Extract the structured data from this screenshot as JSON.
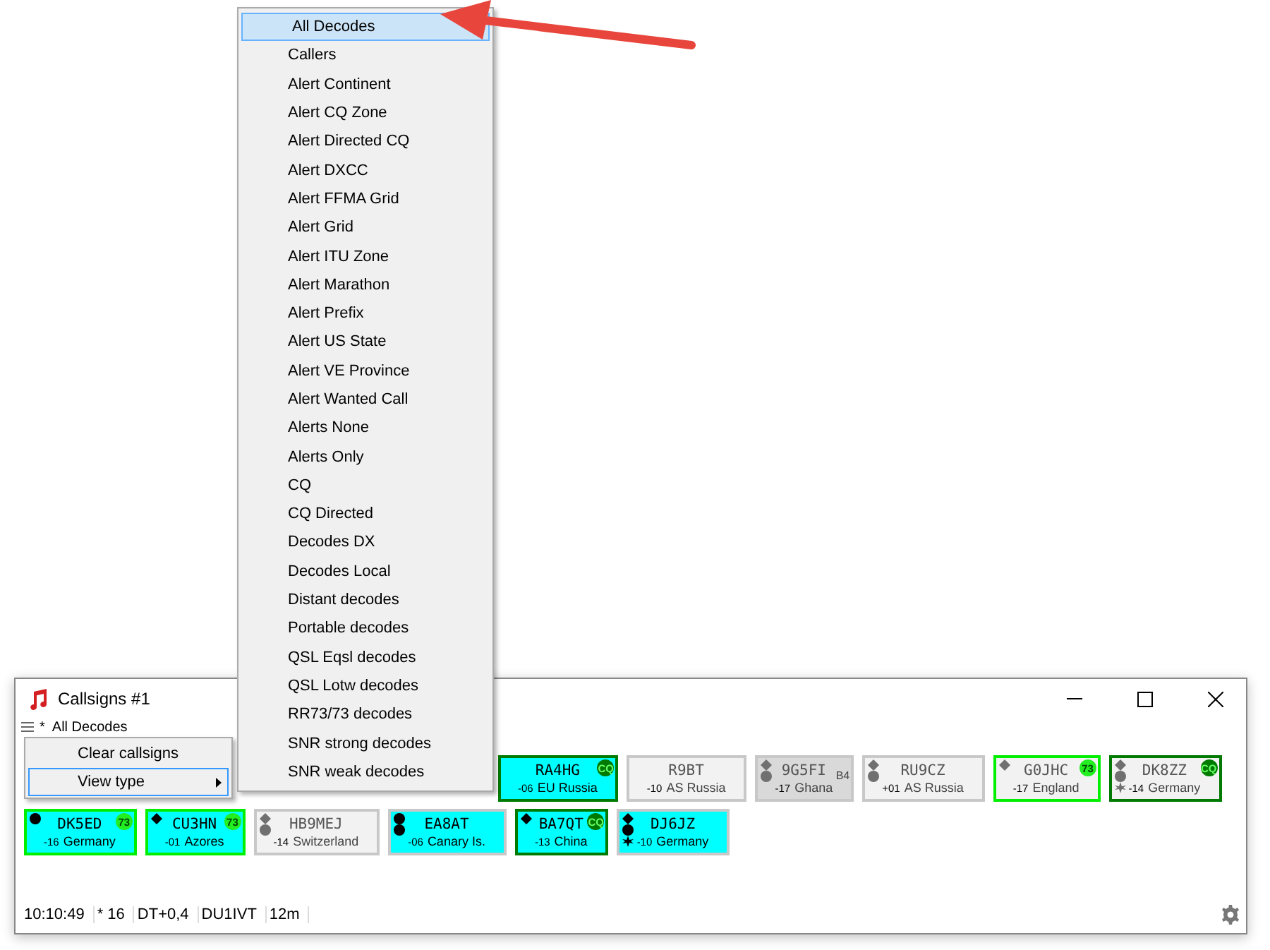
{
  "window": {
    "title": "Callsigns #1"
  },
  "header": {
    "text": "*  All Decodes"
  },
  "context_menu": [
    {
      "label": "Clear callsigns",
      "selected": false,
      "submenu": false
    },
    {
      "label": "View type",
      "selected": true,
      "submenu": true
    }
  ],
  "view_type_menu": [
    {
      "label": "All Decodes",
      "selected": true
    },
    {
      "label": "Callers",
      "selected": false
    },
    {
      "label": "Alert Continent",
      "selected": false
    },
    {
      "label": "Alert CQ Zone",
      "selected": false
    },
    {
      "label": "Alert Directed CQ",
      "selected": false
    },
    {
      "label": "Alert DXCC",
      "selected": false
    },
    {
      "label": "Alert FFMA Grid",
      "selected": false
    },
    {
      "label": "Alert Grid",
      "selected": false
    },
    {
      "label": "Alert ITU Zone",
      "selected": false
    },
    {
      "label": "Alert Marathon",
      "selected": false
    },
    {
      "label": "Alert Prefix",
      "selected": false
    },
    {
      "label": "Alert US State",
      "selected": false
    },
    {
      "label": "Alert VE Province",
      "selected": false
    },
    {
      "label": "Alert Wanted Call",
      "selected": false
    },
    {
      "label": "Alerts None",
      "selected": false
    },
    {
      "label": "Alerts Only",
      "selected": false
    },
    {
      "label": "CQ",
      "selected": false
    },
    {
      "label": "CQ Directed",
      "selected": false
    },
    {
      "label": "Decodes DX",
      "selected": false
    },
    {
      "label": "Decodes Local",
      "selected": false
    },
    {
      "label": "Distant decodes",
      "selected": false
    },
    {
      "label": "Portable decodes",
      "selected": false
    },
    {
      "label": "QSL Eqsl decodes",
      "selected": false
    },
    {
      "label": "QSL Lotw decodes",
      "selected": false
    },
    {
      "label": "RR73/73 decodes",
      "selected": false
    },
    {
      "label": "SNR strong decodes",
      "selected": false
    },
    {
      "label": "SNR weak decodes",
      "selected": false
    }
  ],
  "tile_rows": [
    [
      {
        "callsign": "RA4HG",
        "snr": "-06",
        "country": "EU Russia",
        "color": "#00ffff",
        "dimmed": false,
        "badge": {
          "kind": "cq",
          "text": "CQ"
        }
      },
      {
        "callsign": "R9BT",
        "snr": "-10",
        "country": "AS Russia",
        "color": "#f2f2f2",
        "dimmed": true
      },
      {
        "callsign": "9G5FI",
        "snr": "-17",
        "country": "Ghana",
        "color": "#d9d9d9",
        "dimmed": true,
        "markers": [
          {
            "kind": "diamond"
          },
          {
            "kind": "dot"
          }
        ],
        "badge": {
          "kind": "before",
          "text": "B4"
        }
      },
      {
        "callsign": "RU9CZ",
        "snr": "+01",
        "country": "AS Russia",
        "color": "#f2f2f2",
        "dimmed": true,
        "markers": [
          {
            "kind": "diamond"
          },
          {
            "kind": "dot"
          }
        ]
      },
      {
        "callsign": "G0JHC",
        "snr": "-17",
        "country": "England",
        "color": "#f2f2f2",
        "dimmed": true,
        "markers": [
          {
            "kind": "diamond"
          }
        ],
        "badge": {
          "kind": "reply",
          "text": "73"
        }
      },
      {
        "callsign": "DK8ZZ",
        "snr": "-14",
        "country": "Germany",
        "color": "#f2f2f2",
        "dimmed": true,
        "markers": [
          {
            "kind": "diamond"
          },
          {
            "kind": "dot"
          },
          {
            "kind": "star"
          }
        ],
        "badge": {
          "kind": "cq",
          "text": "CQ"
        }
      }
    ],
    [
      {
        "callsign": "DK5ED",
        "snr": "-16",
        "country": "Germany",
        "color": "#00ffff",
        "dimmed": false,
        "markers": [
          {
            "kind": "dot"
          }
        ],
        "badge": {
          "kind": "reply",
          "text": "73"
        }
      },
      {
        "callsign": "CU3HN",
        "snr": "-01",
        "country": "Azores",
        "color": "#00ffff",
        "dimmed": false,
        "markers": [
          {
            "kind": "diamond"
          }
        ],
        "badge": {
          "kind": "reply",
          "text": "73"
        }
      },
      {
        "callsign": "HB9MEJ",
        "snr": "-14",
        "country": "Switzerland",
        "color": "#f2f2f2",
        "dimmed": true,
        "markers": [
          {
            "kind": "diamond"
          },
          {
            "kind": "dot"
          }
        ]
      },
      {
        "callsign": "EA8AT",
        "snr": "-06",
        "country": "Canary Is.",
        "color": "#00ffff",
        "dimmed": false,
        "markers": [
          {
            "kind": "dot"
          },
          {
            "kind": "dot"
          }
        ]
      },
      {
        "callsign": "BA7QT",
        "snr": "-13",
        "country": "China",
        "color": "#00ffff",
        "dimmed": false,
        "markers": [
          {
            "kind": "diamond"
          }
        ],
        "badge": {
          "kind": "cq",
          "text": "CQ"
        }
      },
      {
        "callsign": "DJ6JZ",
        "snr": "-10",
        "country": "Germany",
        "color": "#00ffff",
        "dimmed": false,
        "markers": [
          {
            "kind": "diamond"
          },
          {
            "kind": "dot"
          },
          {
            "kind": "star"
          }
        ]
      }
    ]
  ],
  "status_bar": [
    "10:10:49",
    "* 16",
    "DT+0,4",
    "DU1IVT",
    "12m"
  ]
}
